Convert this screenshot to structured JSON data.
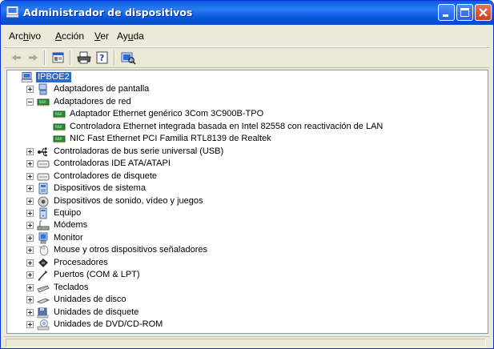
{
  "window": {
    "title": "Administrador de dispositivos"
  },
  "menu": [
    {
      "pre": "Arc",
      "acc": "h",
      "post": "ivo"
    },
    {
      "pre": "",
      "acc": "A",
      "post": "cción"
    },
    {
      "pre": "",
      "acc": "V",
      "post": "er"
    },
    {
      "pre": "Ay",
      "acc": "u",
      "post": "da"
    }
  ],
  "toolbar": [
    "back-icon",
    "forward-icon",
    "properties-icon",
    "print-icon",
    "help-icon",
    "scan-hardware-icon"
  ],
  "tree": {
    "root": {
      "label": "IPBOE2",
      "icon": "computer-icon",
      "selected": true
    },
    "items": [
      {
        "label": "Adaptadores de pantalla",
        "icon": "display-adapter-icon",
        "expanded": false
      },
      {
        "label": "Adaptadores de red",
        "icon": "network-adapter-icon",
        "expanded": true,
        "children": [
          {
            "label": "Adaptador Ethernet genérico 3Com 3C900B-TPO",
            "icon": "network-adapter-icon"
          },
          {
            "label": "Controladora Ethernet integrada basada en Intel 82558 con reactivación de LAN",
            "icon": "network-adapter-icon"
          },
          {
            "label": "NIC Fast Ethernet PCI Familia RTL8139 de Realtek",
            "icon": "network-adapter-icon"
          }
        ]
      },
      {
        "label": "Controladoras de bus serie universal (USB)",
        "icon": "usb-icon",
        "expanded": false
      },
      {
        "label": "Controladoras IDE ATA/ATAPI",
        "icon": "ide-controller-icon",
        "expanded": false
      },
      {
        "label": "Controladores de disquete",
        "icon": "floppy-controller-icon",
        "expanded": false
      },
      {
        "label": "Dispositivos de sistema",
        "icon": "system-device-icon",
        "expanded": false
      },
      {
        "label": "Dispositivos de sonido, vídeo y juegos",
        "icon": "sound-icon",
        "expanded": false
      },
      {
        "label": "Equipo",
        "icon": "computer-small-icon",
        "expanded": false
      },
      {
        "label": "Módems",
        "icon": "modem-icon",
        "expanded": false
      },
      {
        "label": "Monitor",
        "icon": "monitor-icon",
        "expanded": false
      },
      {
        "label": "Mouse y otros dispositivos señaladores",
        "icon": "mouse-icon",
        "expanded": false
      },
      {
        "label": "Procesadores",
        "icon": "processor-icon",
        "expanded": false
      },
      {
        "label": "Puertos (COM & LPT)",
        "icon": "port-icon",
        "expanded": false
      },
      {
        "label": "Teclados",
        "icon": "keyboard-icon",
        "expanded": false
      },
      {
        "label": "Unidades de disco",
        "icon": "disk-drive-icon",
        "expanded": false
      },
      {
        "label": "Unidades de disquete",
        "icon": "floppy-drive-icon",
        "expanded": false
      },
      {
        "label": "Unidades de DVD/CD-ROM",
        "icon": "dvd-drive-icon",
        "expanded": false
      }
    ]
  },
  "colors": {
    "titlebar": "#0a5be0",
    "selection": "#316ac5",
    "close_button": "#c9421d",
    "chrome": "#ece9d8"
  }
}
